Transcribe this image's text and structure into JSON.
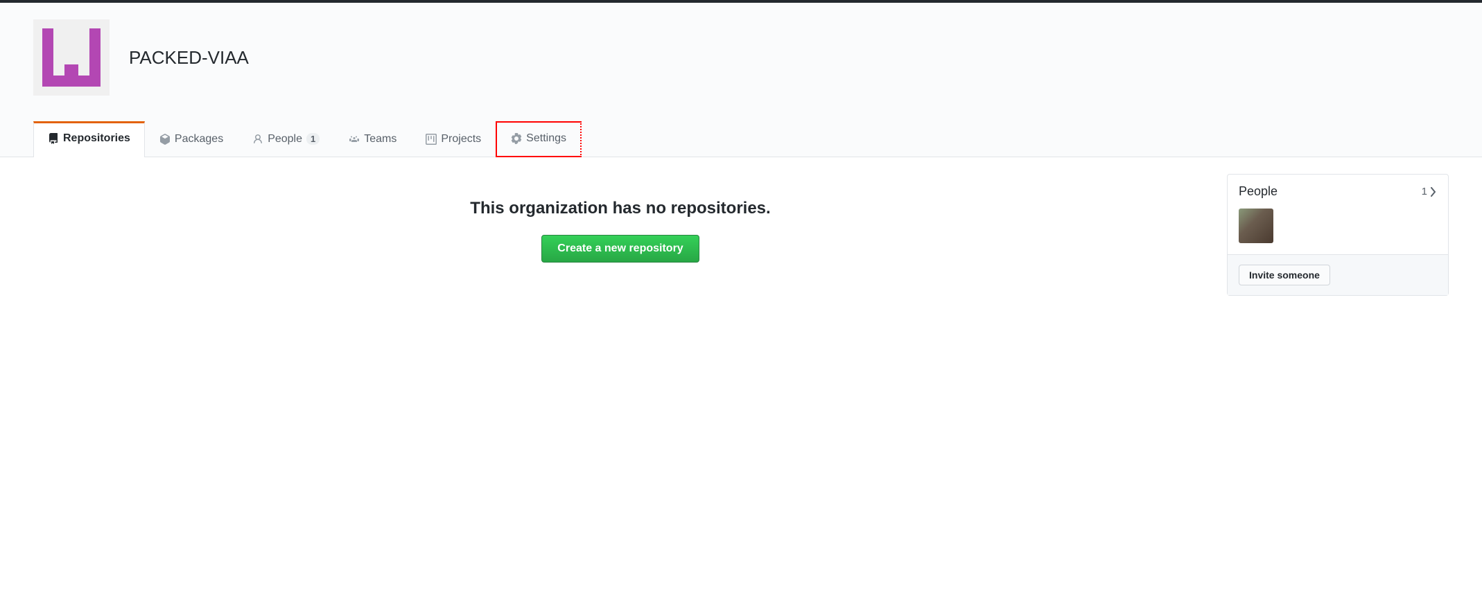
{
  "org": {
    "name": "PACKED-VIAA"
  },
  "tabs": {
    "repositories": {
      "label": "Repositories"
    },
    "packages": {
      "label": "Packages"
    },
    "people": {
      "label": "People",
      "count": "1"
    },
    "teams": {
      "label": "Teams"
    },
    "projects": {
      "label": "Projects"
    },
    "settings": {
      "label": "Settings"
    }
  },
  "main": {
    "empty_message": "This organization has no repositories.",
    "create_button": "Create a new repository"
  },
  "sidebar": {
    "people": {
      "title": "People",
      "count": "1",
      "invite_button": "Invite someone"
    }
  }
}
